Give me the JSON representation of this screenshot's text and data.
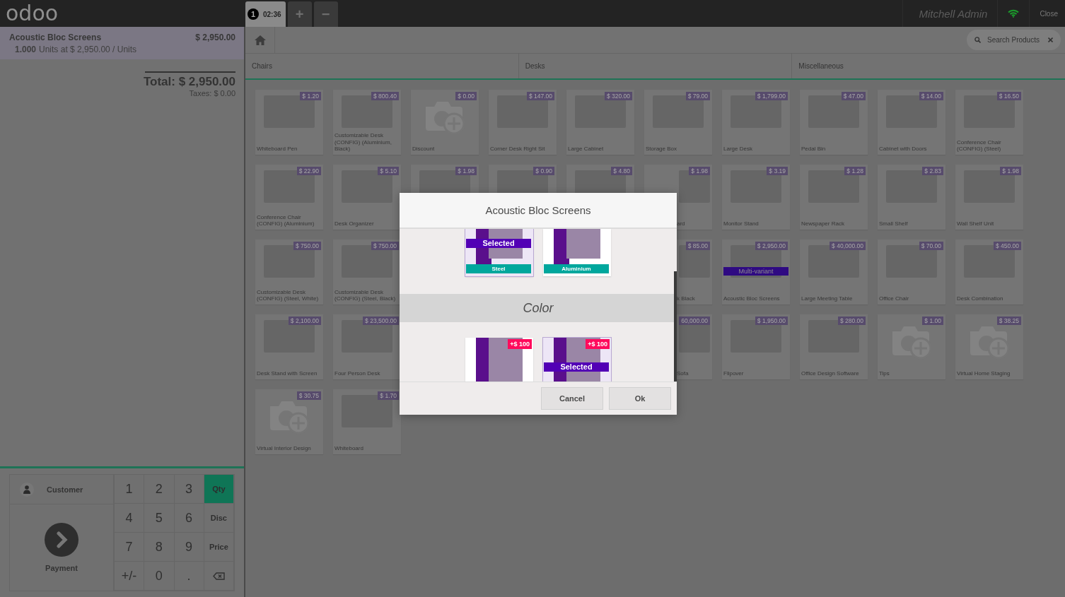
{
  "top_bar": {
    "logo": "odoo",
    "order_tabs": [
      {
        "number": "1",
        "time": "02:36",
        "selected": true
      }
    ],
    "add_button": "+",
    "remove_button": "−",
    "user": "Mitchell Admin",
    "close": "Close"
  },
  "order": {
    "lines": [
      {
        "name": "Acoustic Bloc Screens",
        "price": "$ 2,950.00",
        "quantity": "1.000",
        "detail": "Units at $ 2,950.00 / Units",
        "selected": true
      }
    ],
    "total": "Total: $ 2,950.00",
    "taxes": "Taxes: $ 0.00"
  },
  "actions": {
    "customer": "Customer",
    "payment": "Payment"
  },
  "numpad": [
    {
      "kind": "digit",
      "label": "1"
    },
    {
      "kind": "digit",
      "label": "2"
    },
    {
      "kind": "digit",
      "label": "3"
    },
    {
      "kind": "mode",
      "label": "Qty",
      "selected": true
    },
    {
      "kind": "digit",
      "label": "4"
    },
    {
      "kind": "digit",
      "label": "5"
    },
    {
      "kind": "digit",
      "label": "6"
    },
    {
      "kind": "mode",
      "label": "Disc",
      "selected": false
    },
    {
      "kind": "digit",
      "label": "7"
    },
    {
      "kind": "digit",
      "label": "8"
    },
    {
      "kind": "digit",
      "label": "9"
    },
    {
      "kind": "mode",
      "label": "Price",
      "selected": false
    },
    {
      "kind": "digit",
      "label": "+/-"
    },
    {
      "kind": "digit",
      "label": "0"
    },
    {
      "kind": "digit",
      "label": "."
    },
    {
      "kind": "backspace"
    }
  ],
  "search": {
    "placeholder": "Search Products"
  },
  "categories": [
    "Chairs",
    "Desks",
    "Miscellaneous"
  ],
  "products": [
    {
      "kind": "photo",
      "name": "Whiteboard Pen",
      "price": "$ 1.20"
    },
    {
      "kind": "photo",
      "name": "Customizable Desk (CONFIG) (Aluminium, Black)",
      "price": "$ 800.40"
    },
    {
      "kind": "camera",
      "name": "Discount",
      "price": "$ 0.00"
    },
    {
      "kind": "photo",
      "name": "Corner Desk Right Sit",
      "price": "$ 147.00"
    },
    {
      "kind": "photo",
      "name": "Large Cabinet",
      "price": "$ 320.00"
    },
    {
      "kind": "photo",
      "name": "Storage Box",
      "price": "$ 79.00"
    },
    {
      "kind": "photo",
      "name": "Large Desk",
      "price": "$ 1,799.00"
    },
    {
      "kind": "photo",
      "name": "Pedal Bin",
      "price": "$ 47.00"
    },
    {
      "kind": "photo",
      "name": "Cabinet with Doors",
      "price": "$ 14.00"
    },
    {
      "kind": "photo",
      "name": "Conference Chair (CONFIG) (Steel)",
      "price": "$ 16.50"
    },
    {
      "kind": "photo",
      "name": "Conference Chair (CONFIG) (Aluminium)",
      "price": "$ 22.90"
    },
    {
      "kind": "photo",
      "name": "Desk Organizer",
      "price": "$ 5.10"
    },
    {
      "kind": "photo",
      "price": "$ 1.98"
    },
    {
      "kind": "photo",
      "price": "$ 0.90"
    },
    {
      "kind": "photo",
      "price": "$ 4.80"
    },
    {
      "kind": "clipped",
      "name": "ard",
      "price": "$ 1.98"
    },
    {
      "kind": "photo",
      "name": "Monitor Stand",
      "price": "$ 3.19"
    },
    {
      "kind": "photo",
      "name": "Newspaper Rack",
      "price": "$ 1.28"
    },
    {
      "kind": "photo",
      "name": "Small Shelf",
      "price": "$ 2.83"
    },
    {
      "kind": "photo",
      "name": "Wall Shelf Unit",
      "price": "$ 1.98"
    },
    {
      "kind": "photo",
      "name": "Customizable Desk (CONFIG) (Steel, White)",
      "price": "$ 750.00"
    },
    {
      "kind": "photo",
      "name": "Customizable Desk (CONFIG) (Steel, Black)",
      "price": "$ 750.00"
    },
    {
      "kind": "covered"
    },
    {
      "kind": "covered"
    },
    {
      "kind": "covered"
    },
    {
      "kind": "clipped",
      "name": "k Black",
      "price": "$ 85.00"
    },
    {
      "kind": "photo",
      "name": "Acoustic Bloc Screens",
      "price": "$ 2,950.00",
      "badge": "Multi-variant"
    },
    {
      "kind": "photo",
      "name": "Large Meeting Table",
      "price": "$ 40,000.00"
    },
    {
      "kind": "photo",
      "name": "Office Chair",
      "price": "$ 70.00"
    },
    {
      "kind": "photo",
      "name": "Desk Combination",
      "price": "$ 450.00"
    },
    {
      "kind": "photo",
      "name": "Desk Stand with Screen",
      "price": "$ 2,100.00"
    },
    {
      "kind": "photo",
      "name": "Four Person Desk",
      "price": "$ 23,500.00"
    },
    {
      "kind": "covered"
    },
    {
      "kind": "covered"
    },
    {
      "kind": "covered"
    },
    {
      "kind": "clipped",
      "name": "Sofa",
      "price": "60,000.00"
    },
    {
      "kind": "photo",
      "name": "Flipover",
      "price": "$ 1,950.00"
    },
    {
      "kind": "photo",
      "name": "Office Design Software",
      "price": "$ 280.00"
    },
    {
      "kind": "camera",
      "name": "Tips",
      "price": "$ 1.00"
    },
    {
      "kind": "camera",
      "name": "Virtual Home Staging",
      "price": "$ 38.25"
    },
    {
      "kind": "camera",
      "name": "Virtual Interior Design",
      "price": "$ 30.75"
    },
    {
      "kind": "photo",
      "name": "Whiteboard",
      "price": "$ 1.70"
    }
  ],
  "modal": {
    "title": "Acoustic Bloc Screens",
    "attributes": [
      {
        "options": [
          {
            "label": "Steel",
            "selected": true,
            "badge": "Selected"
          },
          {
            "label": "Aluminium",
            "selected": false
          }
        ]
      },
      {
        "title": "Color",
        "options": [
          {
            "extra": "+$ 100",
            "selected": false
          },
          {
            "extra": "+$ 100",
            "selected": true,
            "badge": "Selected"
          }
        ]
      }
    ],
    "buttons": [
      "Cancel",
      "Ok"
    ]
  }
}
